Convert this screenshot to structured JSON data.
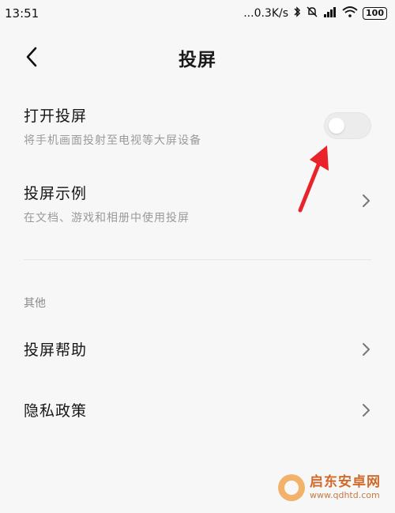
{
  "status_bar": {
    "time": "13:51",
    "network_speed": "...0.3K/s",
    "battery": "100"
  },
  "header": {
    "title": "投屏"
  },
  "settings": {
    "cast": {
      "title": "打开投屏",
      "subtitle": "将手机画面投射至电视等大屏设备",
      "enabled": false
    },
    "examples": {
      "title": "投屏示例",
      "subtitle": "在文档、游戏和相册中使用投屏"
    }
  },
  "section_other": {
    "label": "其他",
    "items": [
      {
        "label": "投屏帮助"
      },
      {
        "label": "隐私政策"
      }
    ]
  },
  "watermark": {
    "text": "启东安卓网",
    "url": "www.qdhtd.com"
  },
  "colors": {
    "background": "#f7f7f7",
    "annotation_arrow": "#e8232a",
    "toggle_off": "#ececec"
  }
}
